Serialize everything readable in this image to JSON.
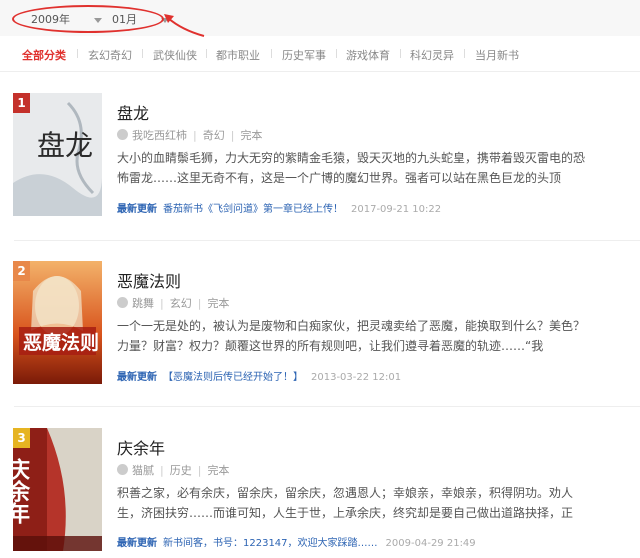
{
  "filters": {
    "year": "2009年",
    "month": "01月"
  },
  "tabs": [
    {
      "label": "全部分类",
      "active": true
    },
    {
      "label": "玄幻奇幻"
    },
    {
      "label": "武侠仙侠"
    },
    {
      "label": "都市职业"
    },
    {
      "label": "历史军事"
    },
    {
      "label": "游戏体育"
    },
    {
      "label": "科幻灵异"
    },
    {
      "label": "当月新书"
    }
  ],
  "books": [
    {
      "rank": "1",
      "cover_text": "盘龙",
      "title": "盘龙",
      "author": "我吃西红柿",
      "category": "奇幻",
      "status": "完本",
      "desc": "大小的血睛鬃毛狮，力大无穷的紫睛金毛猿，毁天灭地的九头蛇皇，携带着毁灭雷电的恐怖雷龙……这里无奇不有，这是一个广博的魔幻世界。强者可以站在黑色巨龙的头顶",
      "update_label": "最新更新",
      "update_text": "番茄新书《飞剑问道》第一章已经上传！",
      "date": "2017-09-21 10:22"
    },
    {
      "rank": "2",
      "cover_text": "恶魔法则",
      "title": "恶魔法则",
      "author": "跳舞",
      "category": "玄幻",
      "status": "完本",
      "desc": "一个一无是处的，被认为是废物和白痴家伙，把灵魂卖给了恶魔，能换取到什么？美色？力量？财富？权力？颠覆这世界的所有规则吧，让我们遵寻着恶魔的轨迹……“我",
      "update_label": "最新更新",
      "update_text": "【恶魔法则后传已经开始了！】",
      "date": "2013-03-22 12:01"
    },
    {
      "rank": "3",
      "cover_text": "庆余年",
      "title": "庆余年",
      "author": "猫腻",
      "category": "历史",
      "status": "完本",
      "desc": "积善之家，必有余庆，留余庆，留余庆，忽遇恩人；幸娘亲，幸娘亲，积得阴功。劝人生，济困扶穷……而谁可知，人生于世，上承余庆，终究却是要自己做出道路抉择，正",
      "update_label": "最新更新",
      "update_text": "新书间客，书号：1223147，欢迎大家踩踏……",
      "date": "2009-04-29 21:49"
    }
  ],
  "colors": {
    "accent": "#e0312e",
    "link": "#2d64b3",
    "rank1": "#c4312b",
    "rank2": "#e8884a",
    "rank3": "#e6b422"
  }
}
